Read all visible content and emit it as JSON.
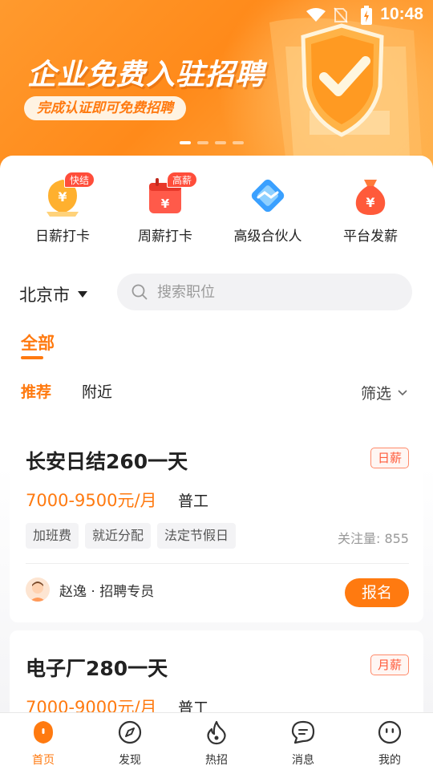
{
  "status_bar": {
    "time": "10:48"
  },
  "banner": {
    "title": "企业免费入驻招聘",
    "subtitle": "完成认证即可免费招聘",
    "page_count": 4,
    "active_page": 1
  },
  "quick_actions": [
    {
      "label": "日薪打卡",
      "badge": "快结",
      "icon": "daily-pay-icon"
    },
    {
      "label": "周薪打卡",
      "badge": "高薪",
      "icon": "calendar-pay-icon"
    },
    {
      "label": "高级合伙人",
      "badge": "",
      "icon": "handshake-icon"
    },
    {
      "label": "平台发薪",
      "badge": "",
      "icon": "money-bag-icon"
    }
  ],
  "location": {
    "city": "北京市"
  },
  "search": {
    "placeholder": "搜索职位"
  },
  "category_tab": "全部",
  "sub_tabs": {
    "recommend": "推荐",
    "nearby": "附近",
    "filter": "筛选"
  },
  "jobs": [
    {
      "title": "长安日结260一天",
      "pay_tag": "日薪",
      "salary": "7000-9500元/月",
      "type": "普工",
      "tags": [
        "加班费",
        "就近分配",
        "法定节假日"
      ],
      "follow": "关注量: 855",
      "recruiter": "赵逸 · 招聘专员",
      "apply": "报名"
    },
    {
      "title": "电子厂280一天",
      "pay_tag": "月薪",
      "salary": "7000-9000元/月",
      "type": "普工"
    }
  ],
  "nav": {
    "home": "首页",
    "discover": "发现",
    "hot": "热招",
    "messages": "消息",
    "mine": "我的"
  },
  "colors": {
    "accent": "#ff7a10",
    "tag_red": "#ff5a3a"
  }
}
